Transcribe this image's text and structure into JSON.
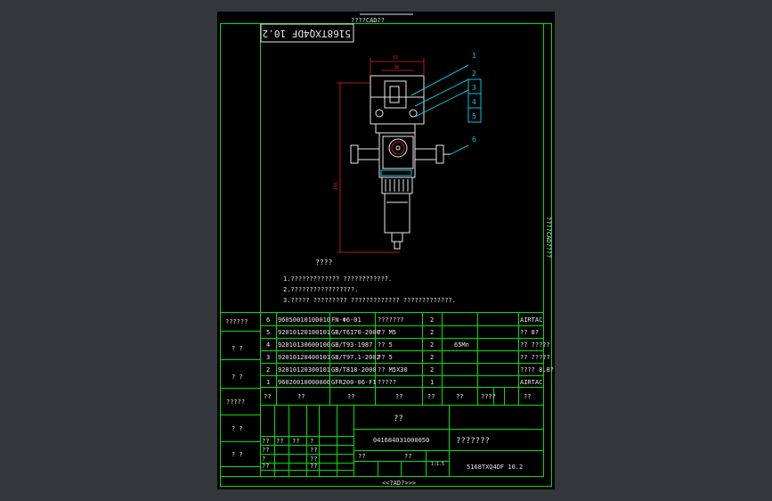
{
  "drawing": {
    "top_label": "????CAD??",
    "bottom_label": "<<?AD?>>>",
    "right_label": "????CAD????",
    "stamp_code": "5168TXQ4DF 10.2",
    "dim_55": "55",
    "dim_38": "38",
    "dim_vertical": "145",
    "balloons": [
      "1",
      "2",
      "3",
      "4",
      "5",
      "6"
    ]
  },
  "notes": {
    "title": "????",
    "lines": [
      "1.????????????? ????????????.",
      "2.?????????????????.",
      "3.????? ????????? ????????????? ?????????????."
    ]
  },
  "bom": {
    "rows": [
      {
        "no": "6",
        "code": "96050010100010",
        "std": "FN-Φ6-01",
        "name": "???????",
        "qty": "2",
        "mat": "",
        "note": "AIRTAC"
      },
      {
        "no": "5",
        "code": "92010120100101",
        "std": "GB/T6170-2000",
        "name": "?? M5",
        "qty": "2",
        "mat": "",
        "note": "?? 8?"
      },
      {
        "no": "4",
        "code": "92010130600100",
        "std": "GB/T93-1987",
        "name": "?? 5",
        "qty": "2",
        "mat": "65Mn",
        "note": "?? ?????"
      },
      {
        "no": "3",
        "code": "92010120400101",
        "std": "GB/T97.1-2002",
        "name": "?? 5",
        "qty": "2",
        "mat": "",
        "note": "?? ?????"
      },
      {
        "no": "2",
        "code": "92010120300101",
        "std": "GB/T818-2000",
        "name": "?? M5X30",
        "qty": "2",
        "mat": "",
        "note": "???? 8.8?"
      },
      {
        "no": "1",
        "code": "96020010000006",
        "std": "GFR200-06-F1",
        "name": "?????",
        "qty": "1",
        "mat": "",
        "note": "AIRTAC"
      }
    ],
    "header": [
      "??",
      "??",
      "??",
      "??",
      "??",
      "??",
      "????",
      "??"
    ]
  },
  "side": {
    "cells": [
      "??????",
      "? ?",
      "? ?",
      "?????",
      "? ?",
      "? ?"
    ]
  },
  "title_block": {
    "name": "??",
    "drawing_no": "041684031000050",
    "company": "???????",
    "code": "5168TXQ4DF 10.2",
    "scale": "1:1.5",
    "small": [
      "??",
      "??",
      "??",
      "?",
      "??",
      "??",
      "?",
      "??",
      "??",
      "??",
      "??",
      "??"
    ]
  }
}
